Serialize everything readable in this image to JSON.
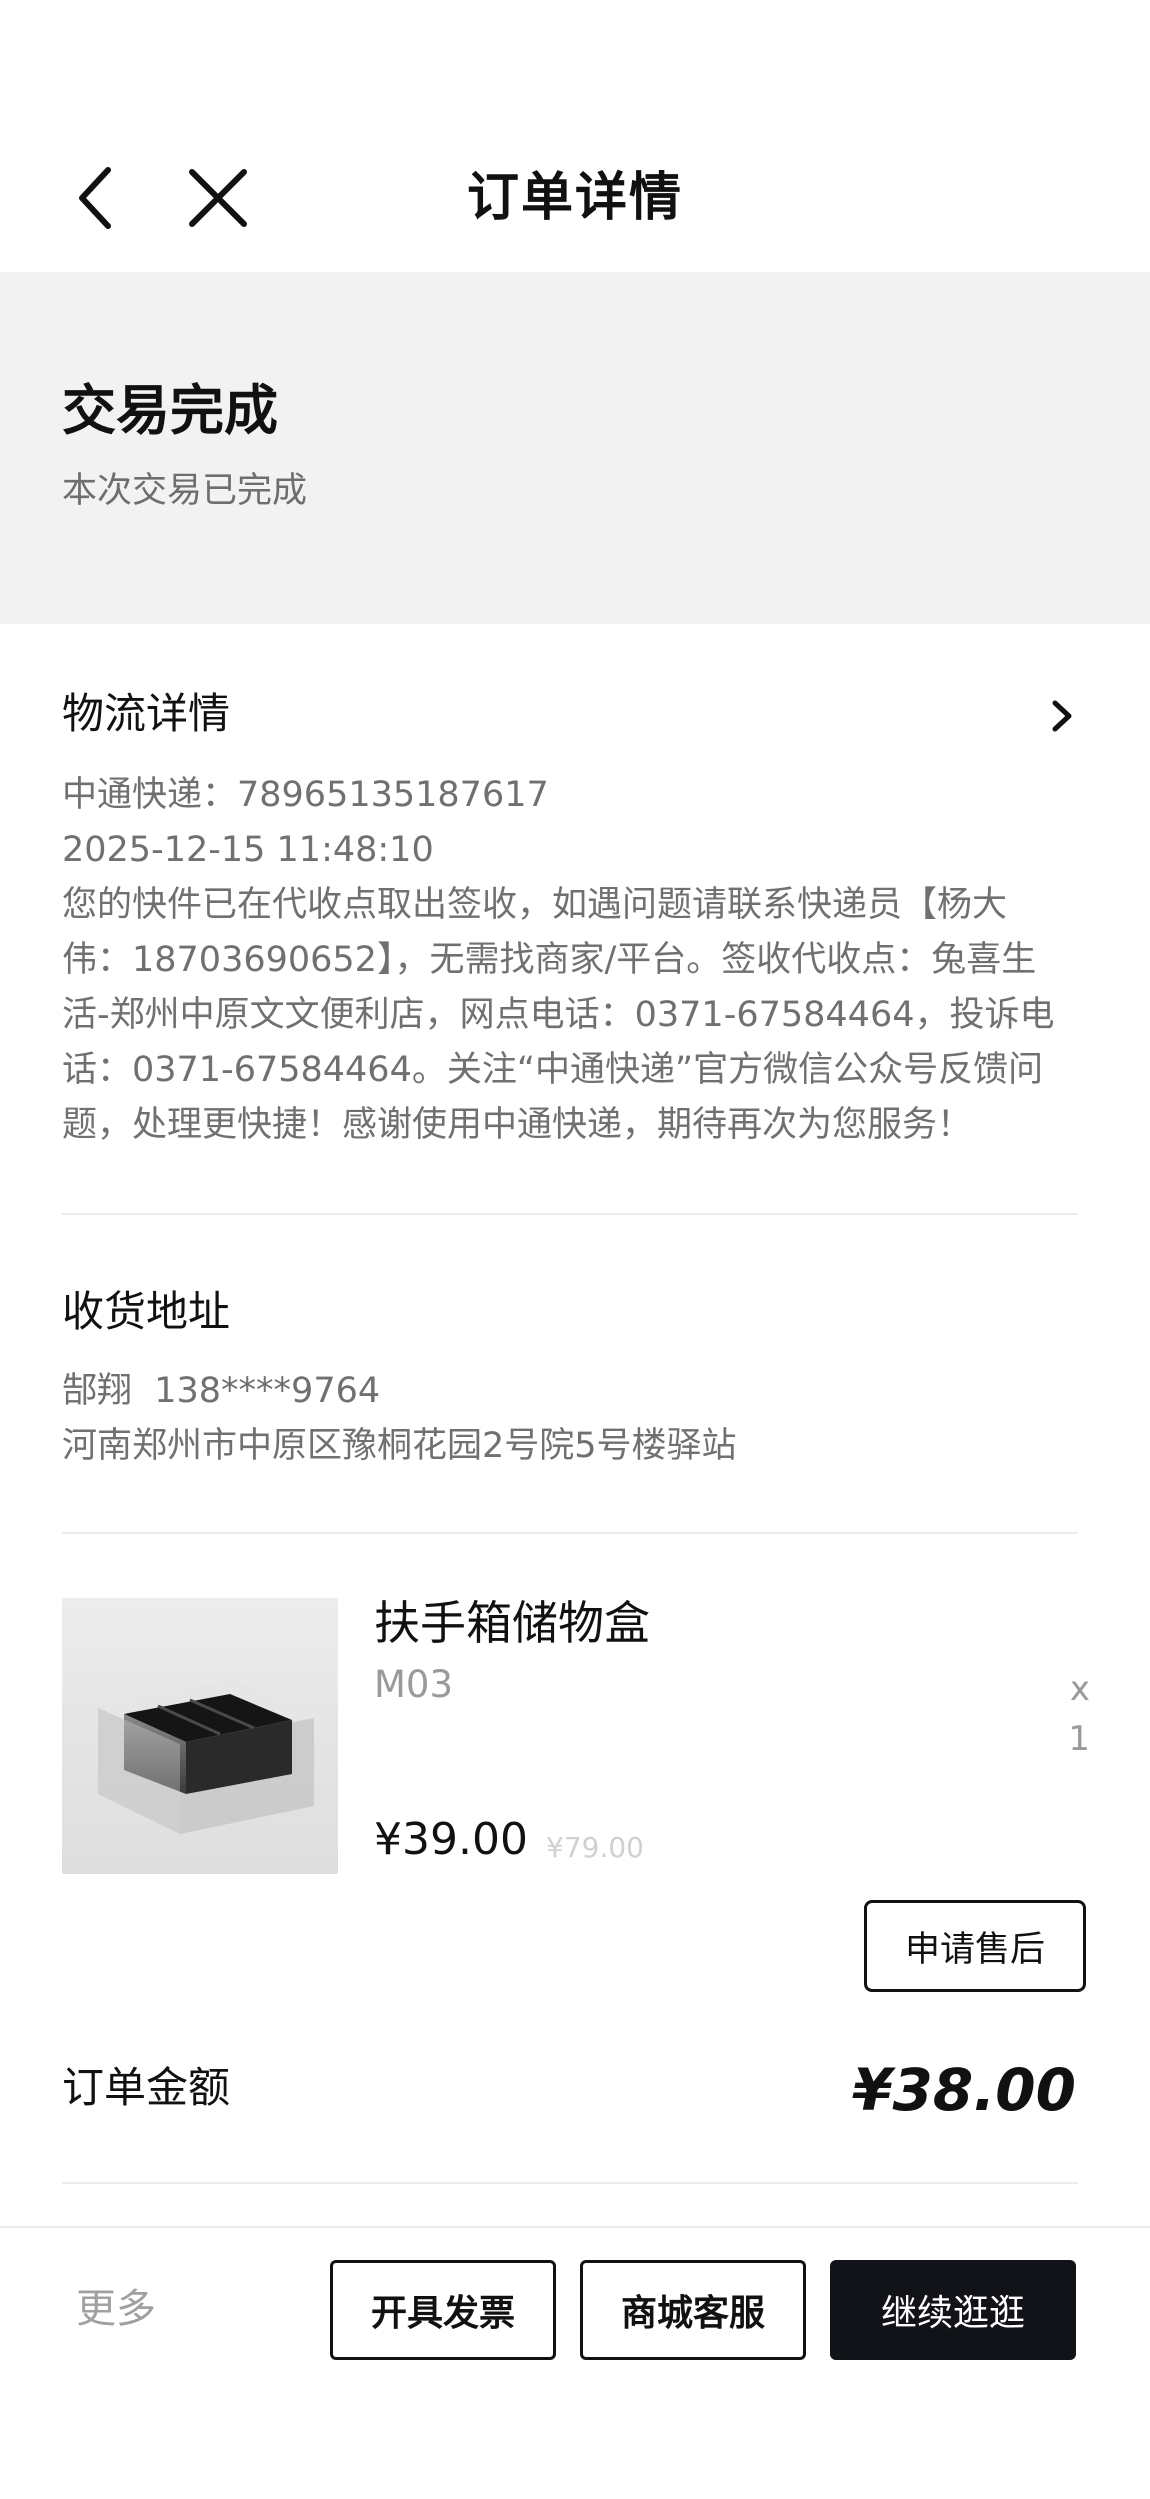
{
  "header": {
    "title": "订单详情",
    "back_icon": "chevron-left-icon",
    "close_icon": "close-icon"
  },
  "status": {
    "title": "交易完成",
    "subtitle": "本次交易已完成"
  },
  "logistics": {
    "title": "物流详情",
    "carrier_line": "中通快递：78965135187617",
    "time": "2025-12-15 11:48:10",
    "message_lines": [
      "您的快件已在代收点取出签收，如遇问题请联系快递员【杨大",
      "伟：18703690652】，无需找商家/平台。签收代收点：兔喜生",
      "活-郑州中原文文便利店，网点电话：0371-67584464，投诉电",
      "话：0371-67584464。关注“中通快递”官方微信公众号反馈问",
      "题，处理更快捷！感谢使用中通快递，期待再次为您服务！"
    ]
  },
  "address": {
    "title": "收货地址",
    "contact": "郜翔  138****9764",
    "detail": "河南郑州市中原区豫桐花园2号院5号楼驿站"
  },
  "product": {
    "name": "扶手箱储物盒",
    "spec": "M03",
    "quantity": "x 1",
    "price": "¥39.00",
    "original_price": "¥79.00",
    "after_sale_label": "申请售后"
  },
  "order": {
    "amount_label": "订单金额",
    "amount_value": "¥38.00"
  },
  "bottom_bar": {
    "more_label": "更多",
    "invoice_label": "开具发票",
    "service_label": "商城客服",
    "continue_label": "继续逛逛"
  },
  "colors": {
    "primary_button": "#111318",
    "status_background": "#f2f2f2"
  }
}
